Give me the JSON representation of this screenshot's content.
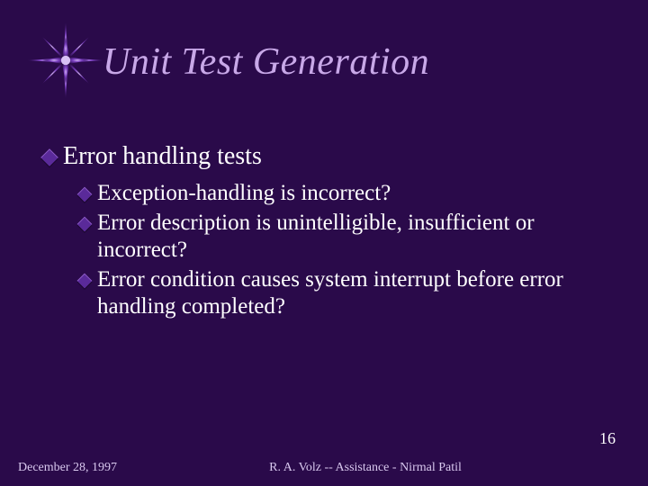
{
  "title": "Unit Test Generation",
  "bullets": {
    "l1": "Error handling tests",
    "l2": [
      "Exception-handling is incorrect?",
      "Error description is unintelligible, insufficient or incorrect?",
      "Error condition causes system interrupt before error handling completed?"
    ]
  },
  "footer": {
    "date": "December 28, 1997",
    "center": "R. A. Volz  --  Assistance - Nirmal Patil",
    "page": "16"
  }
}
